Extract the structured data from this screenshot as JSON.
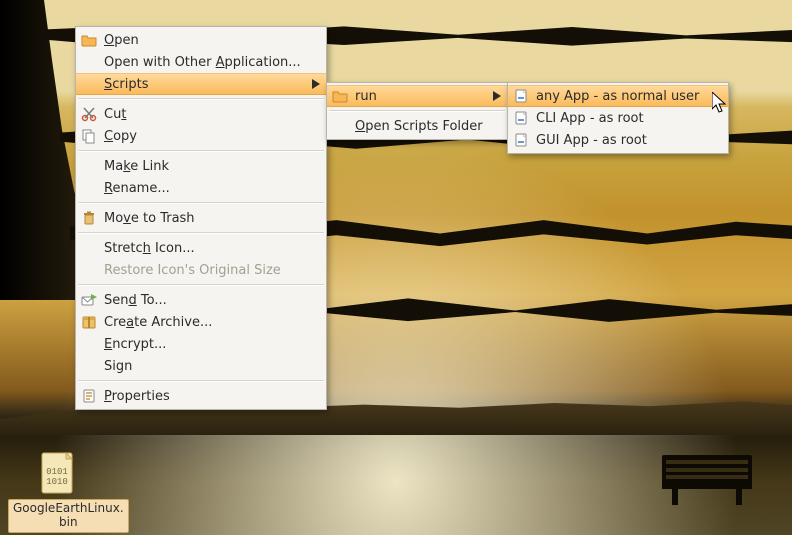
{
  "desktop": {
    "icon": {
      "label": "GoogleEarthLinux.\nbin"
    }
  },
  "menu_main": {
    "open": {
      "prefix": "",
      "ul": "O",
      "suffix": "pen"
    },
    "open_with": {
      "prefix": "Open with Other ",
      "ul": "A",
      "suffix": "pplication..."
    },
    "scripts": {
      "prefix": "",
      "ul": "S",
      "suffix": "cripts"
    },
    "cut": {
      "prefix": "Cu",
      "ul": "t",
      "suffix": ""
    },
    "copy": {
      "prefix": "",
      "ul": "C",
      "suffix": "opy"
    },
    "make_link": {
      "prefix": "Ma",
      "ul": "k",
      "suffix": "e Link"
    },
    "rename": {
      "prefix": "",
      "ul": "R",
      "suffix": "ename..."
    },
    "trash": {
      "prefix": "Mo",
      "ul": "v",
      "suffix": "e to Trash"
    },
    "stretch": {
      "prefix": "Stretc",
      "ul": "h",
      "suffix": " Icon..."
    },
    "restore": "Restore Icon's Original Size",
    "send_to": {
      "prefix": "Sen",
      "ul": "d",
      "suffix": " To..."
    },
    "archive": {
      "prefix": "Cre",
      "ul": "a",
      "suffix": "te Archive..."
    },
    "encrypt": {
      "prefix": "",
      "ul": "E",
      "suffix": "ncrypt..."
    },
    "sign": "Sign",
    "properties": {
      "prefix": "",
      "ul": "P",
      "suffix": "roperties"
    }
  },
  "menu_scripts": {
    "run": "run",
    "open_folder": {
      "prefix": "",
      "ul": "O",
      "suffix": "pen Scripts Folder"
    }
  },
  "menu_run": {
    "any_normal": "any App - as normal user",
    "cli_root": "CLI App - as root",
    "gui_root": "GUI App - as root"
  }
}
